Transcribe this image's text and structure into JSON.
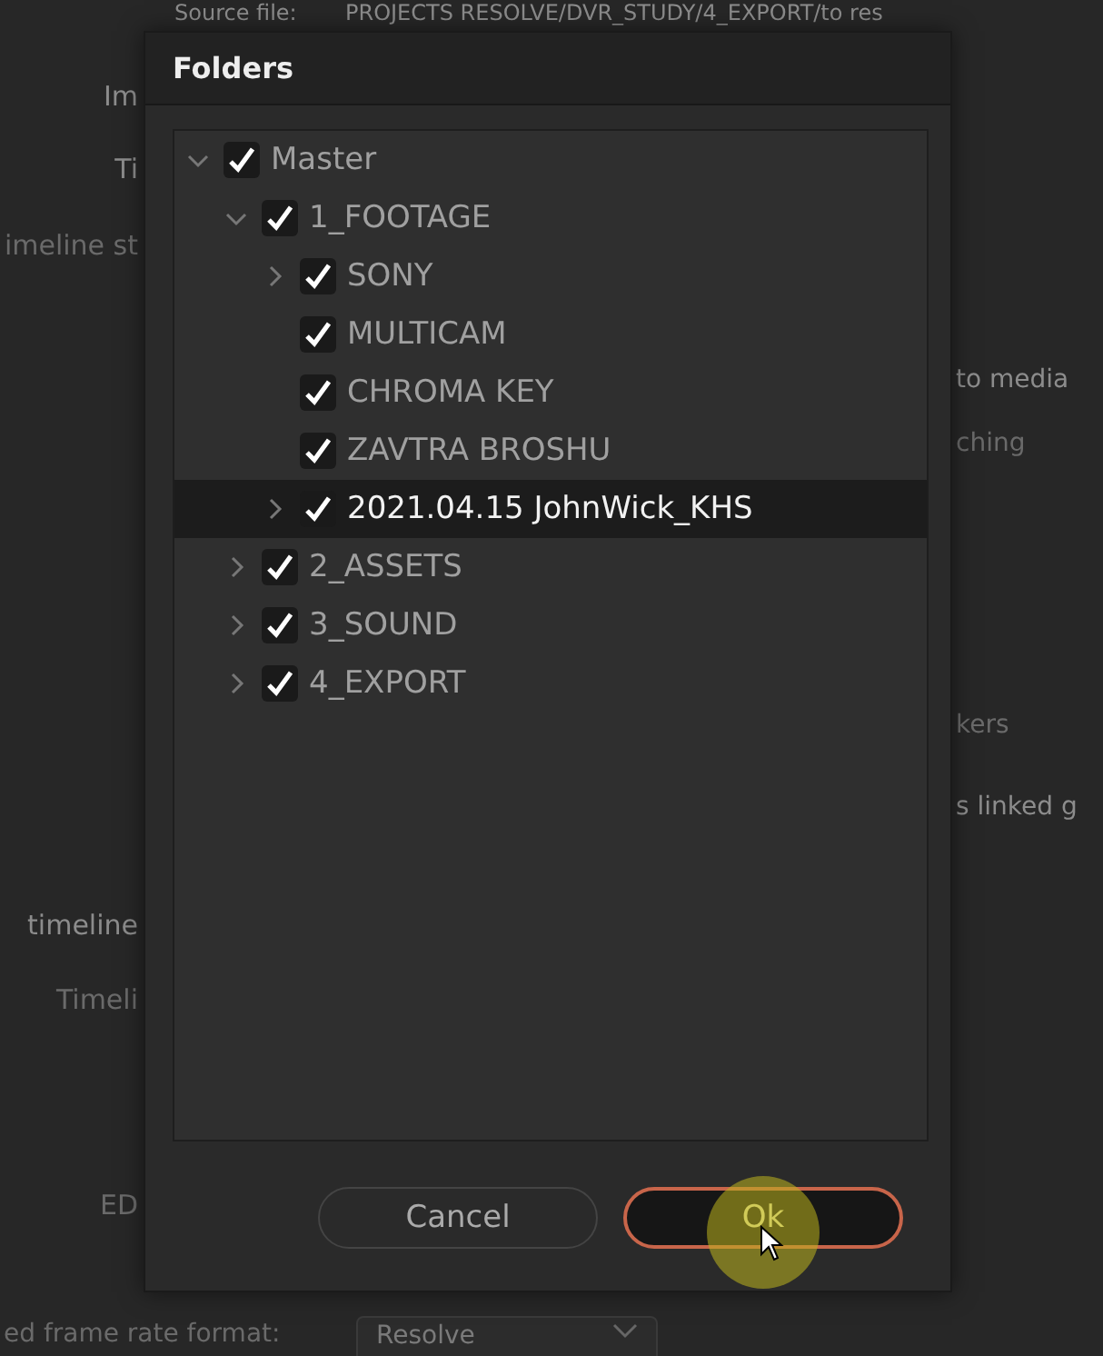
{
  "background": {
    "source_label": "Source file:",
    "source_path": "PROJECTS RESOLVE/DVR_STUDY/4_EXPORT/to res",
    "fragments": [
      "Im",
      "Ti",
      "imeline st",
      "to media",
      "ching",
      "kers",
      "s linked g",
      "timeline",
      "Timeli",
      "ED"
    ],
    "frame_rate_label": "ed frame rate format:",
    "frame_rate_value": "Resolve"
  },
  "dialog": {
    "title": "Folders",
    "tree": [
      {
        "label": "Master",
        "checked": true,
        "expanded": true,
        "selected": false,
        "children": [
          {
            "label": "1_FOOTAGE",
            "checked": true,
            "expanded": true,
            "selected": false,
            "children": [
              {
                "label": "SONY",
                "checked": true,
                "expanded": false,
                "selected": false
              },
              {
                "label": "MULTICAM",
                "checked": true,
                "selected": false
              },
              {
                "label": "CHROMA KEY",
                "checked": true,
                "selected": false
              },
              {
                "label": "ZAVTRA BROSHU",
                "checked": true,
                "selected": false
              },
              {
                "label": "2021.04.15 JohnWick_KHS",
                "checked": true,
                "expanded": false,
                "selected": true
              }
            ]
          },
          {
            "label": "2_ASSETS",
            "checked": true,
            "expanded": false,
            "selected": false
          },
          {
            "label": "3_SOUND",
            "checked": true,
            "expanded": false,
            "selected": false
          },
          {
            "label": "4_EXPORT",
            "checked": true,
            "expanded": false,
            "selected": false
          }
        ]
      }
    ],
    "buttons": [
      {
        "label": "Cancel",
        "kind": "default"
      },
      {
        "label": "Ok",
        "kind": "primary"
      }
    ]
  }
}
